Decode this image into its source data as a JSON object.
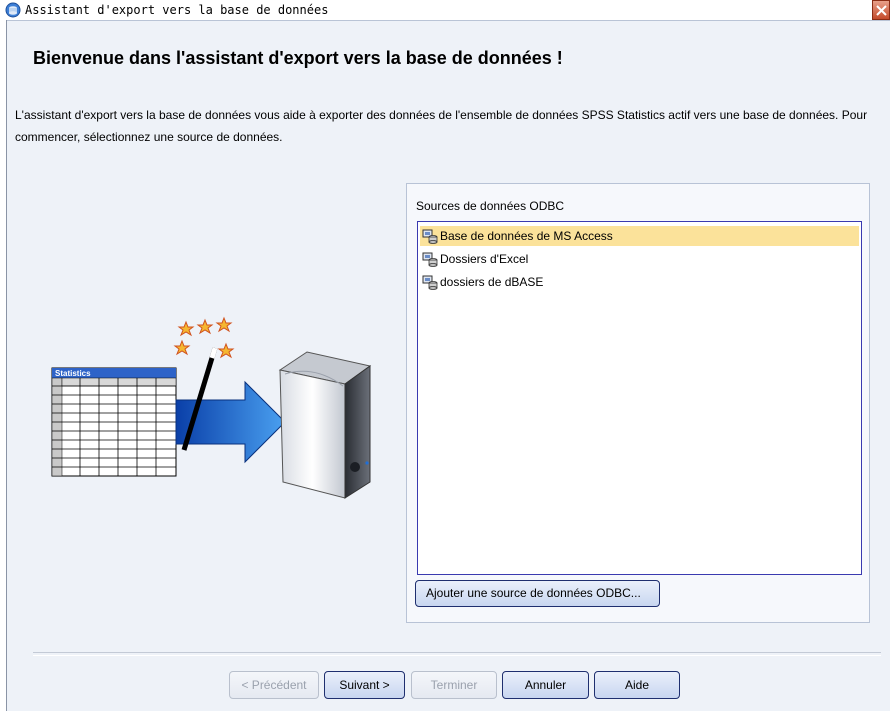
{
  "window": {
    "title": "Assistant d'export vers la base de données",
    "icon": "database-export-icon"
  },
  "main": {
    "heading": "Bienvenue dans l'assistant d'export vers la base de données !",
    "description": "L'assistant d'export vers la base de données vous aide à exporter des données de l'ensemble de données SPSS Statistics actif vers une base de données. Pour commencer, sélectionnez une source de données."
  },
  "illustration": {
    "table_label": "Statistics",
    "icons": [
      "spreadsheet-icon",
      "magic-wand-icon",
      "arrow-icon",
      "server-icon"
    ]
  },
  "datasources": {
    "label": "Sources de données ODBC",
    "items": [
      {
        "label": "Base de données de MS Access",
        "selected": true
      },
      {
        "label": "Dossiers d'Excel",
        "selected": false
      },
      {
        "label": "dossiers de dBASE",
        "selected": false
      }
    ],
    "add_button": "Ajouter une source de données ODBC..."
  },
  "footer": {
    "prev": "< Précédent",
    "next": "Suivant >",
    "finish": "Terminer",
    "cancel": "Annuler",
    "help": "Aide"
  },
  "colors": {
    "selection": "#fbe29a",
    "background": "#eef2f8",
    "list_border": "#3a3ab0"
  }
}
